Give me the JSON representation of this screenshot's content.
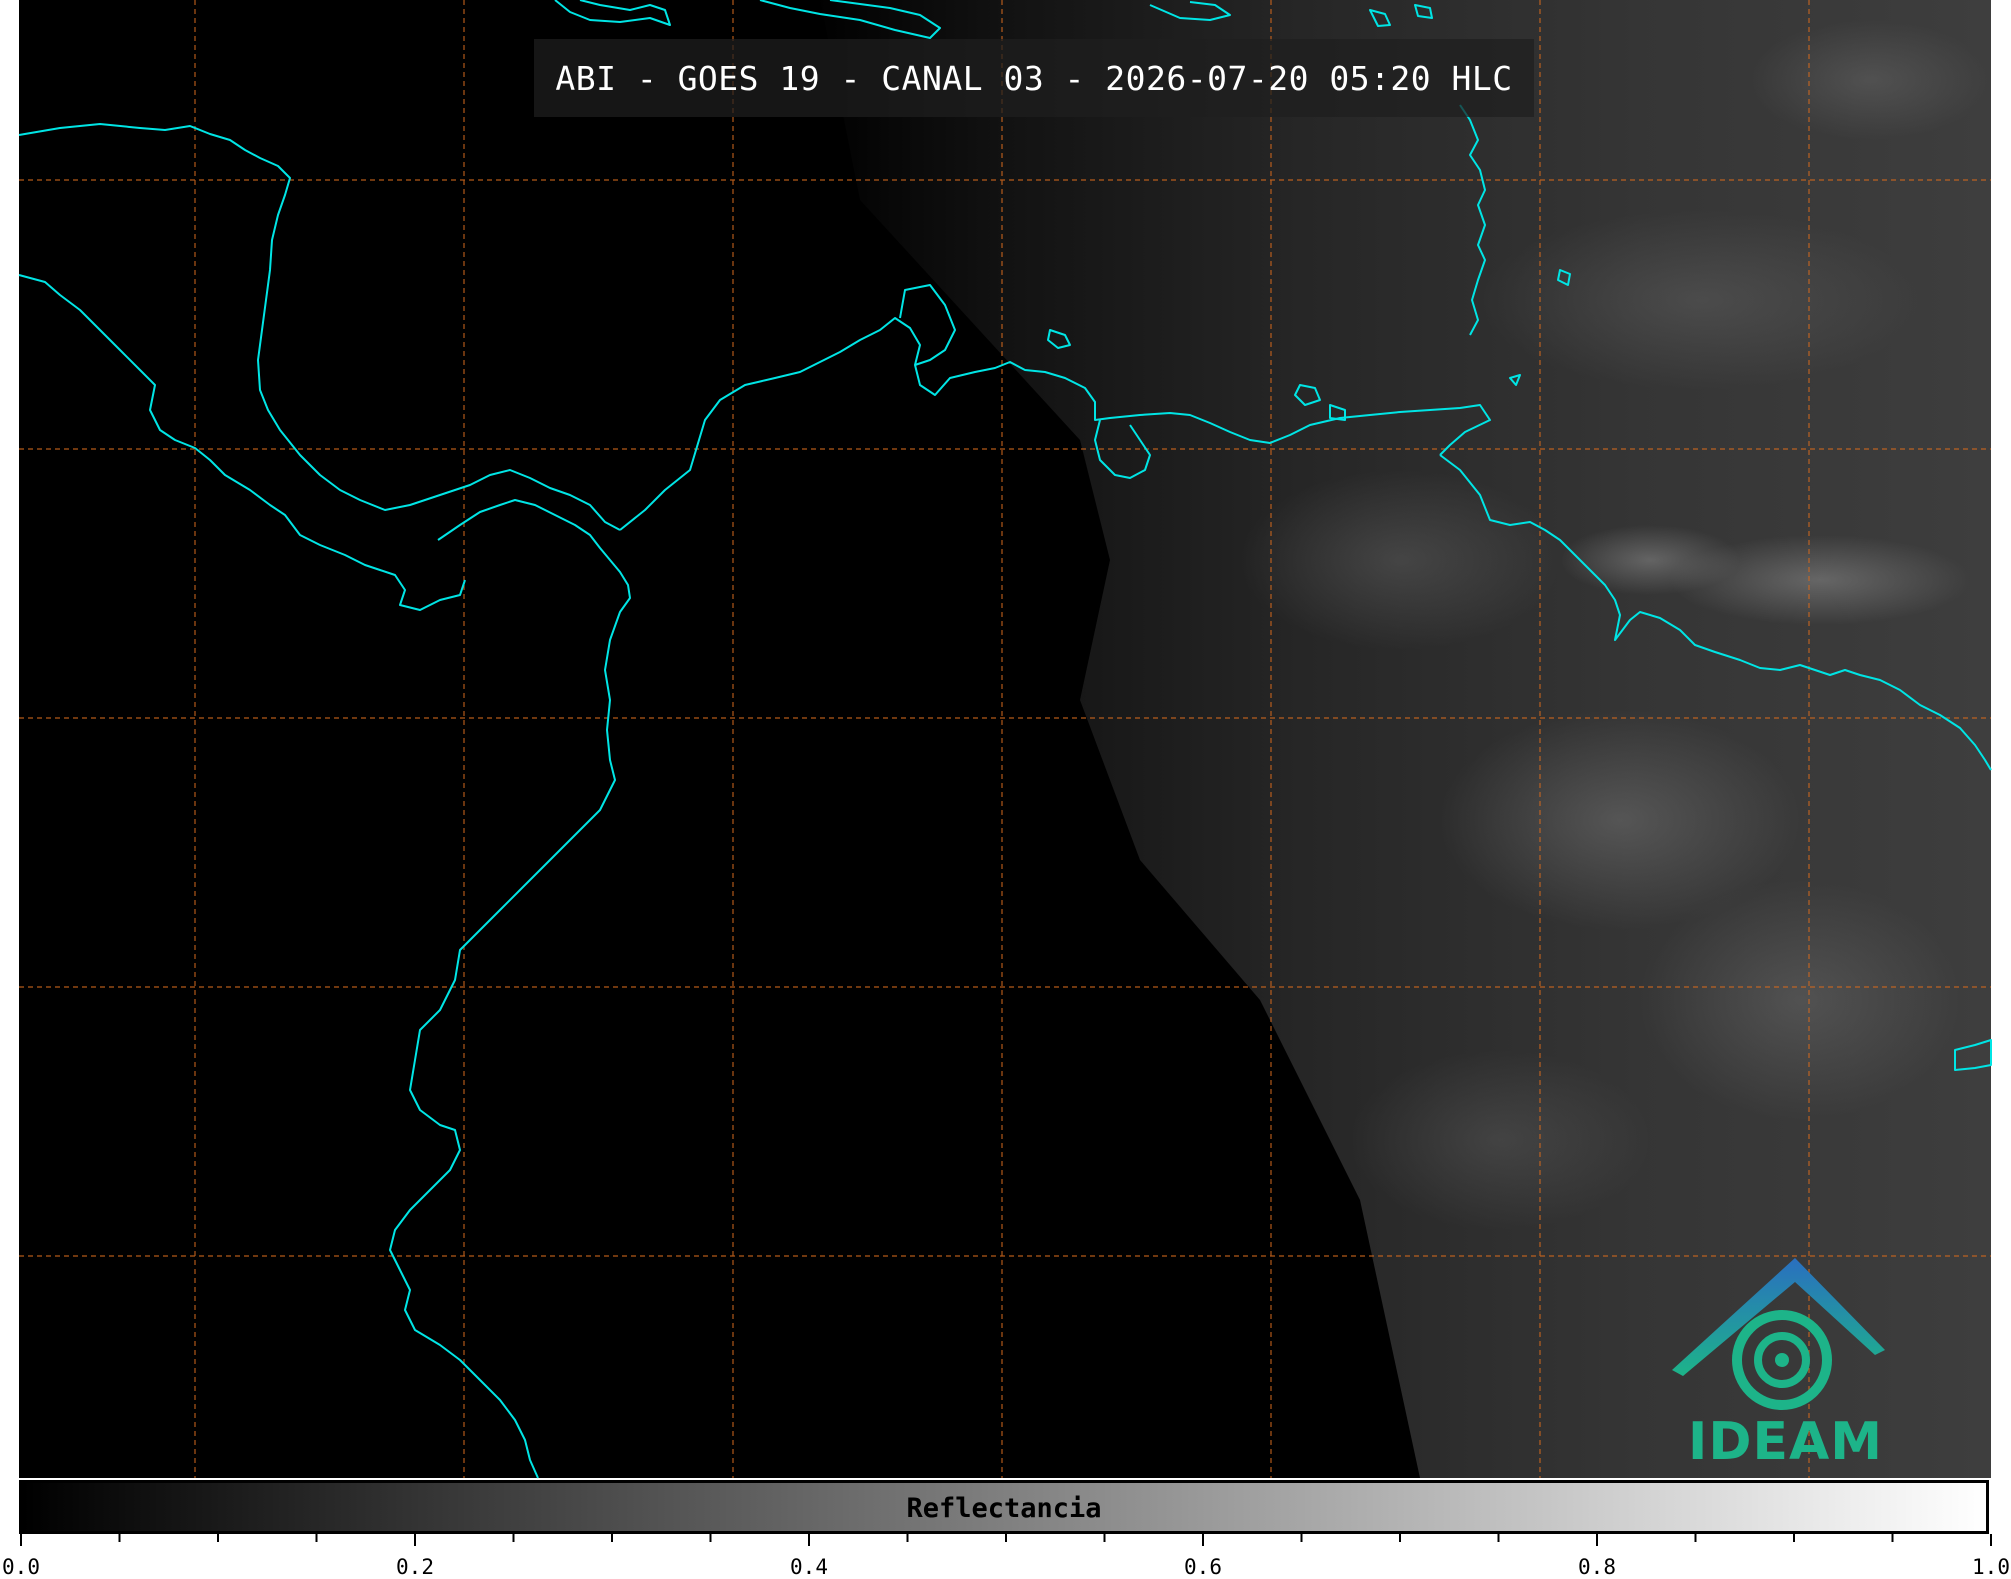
{
  "title": "ABI - GOES 19 - CANAL 03 - 2026-07-20 05:20 HLC",
  "logo": {
    "text": "IDEAM",
    "color_dark": "#2a6fc0",
    "color_light": "#1db489"
  },
  "colorbar": {
    "label": "Reflectancia",
    "ticks": [
      "0.0",
      "0.2",
      "0.4",
      "0.6",
      "0.8",
      "1.0"
    ],
    "range": [
      0,
      1
    ]
  },
  "colors": {
    "coastline": "#00e5e5",
    "gridlines": "#d2691e",
    "background": "#000000"
  }
}
